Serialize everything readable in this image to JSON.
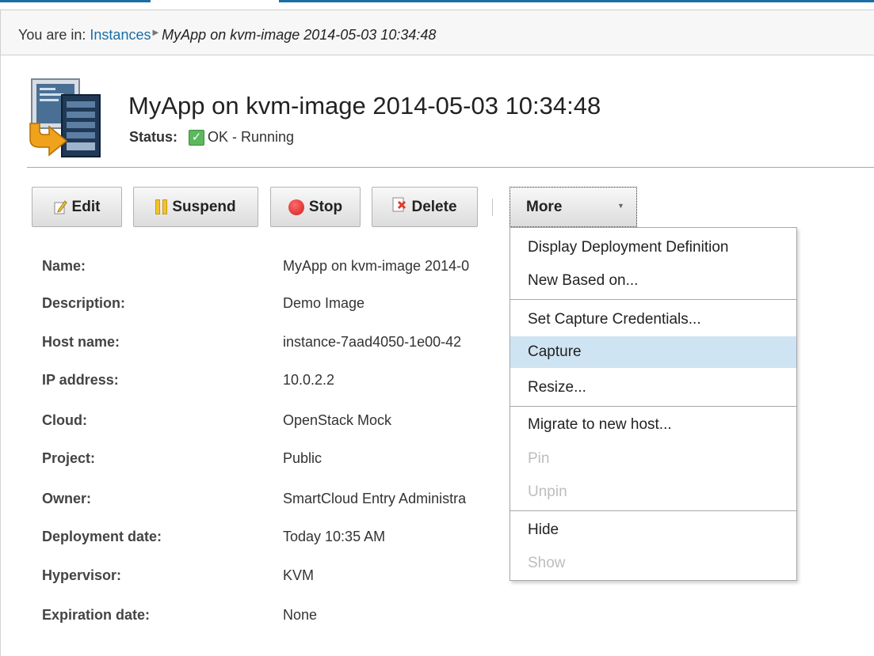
{
  "breadcrumb": {
    "prefix": "You are in:",
    "link": "Instances",
    "current": "MyApp on kvm-image 2014-05-03 10:34:48"
  },
  "header": {
    "title": "MyApp on kvm-image 2014-05-03 10:34:48",
    "status_label": "Status:",
    "status_value": "OK - Running",
    "status_color": "#5cb85c"
  },
  "toolbar": {
    "edit_label": "Edit",
    "suspend_label": "Suspend",
    "stop_label": "Stop",
    "delete_label": "Delete",
    "more_label": "More"
  },
  "properties": [
    {
      "label": "Name:",
      "value": "MyApp on kvm-image 2014-0"
    },
    {
      "label": "Description:",
      "value": "Demo Image"
    },
    {
      "label": "Host name:",
      "value": "instance-7aad4050-1e00-42"
    },
    {
      "label": "IP address:",
      "value": "10.0.2.2"
    },
    {
      "label": "Cloud:",
      "value": "OpenStack Mock"
    },
    {
      "label": "Project:",
      "value": "Public"
    },
    {
      "label": "Owner:",
      "value": "SmartCloud Entry Administra"
    },
    {
      "label": "Deployment date:",
      "value": "Today 10:35 AM"
    },
    {
      "label": "Hypervisor:",
      "value": "KVM"
    },
    {
      "label": "Expiration date:",
      "value": "None"
    }
  ],
  "more_menu": {
    "items": [
      {
        "label": "Display Deployment Definition",
        "enabled": true
      },
      {
        "label": "New Based on...",
        "enabled": true
      },
      {
        "label": "Set Capture Credentials...",
        "enabled": true
      },
      {
        "label": "Capture",
        "enabled": true,
        "highlighted": true
      },
      {
        "label": "Resize...",
        "enabled": true
      },
      {
        "label": "Migrate to new host...",
        "enabled": true
      },
      {
        "label": "Pin",
        "enabled": false
      },
      {
        "label": "Unpin",
        "enabled": false
      },
      {
        "label": "Hide",
        "enabled": true
      },
      {
        "label": "Show",
        "enabled": false
      }
    ]
  },
  "colors": {
    "accent": "#1a6ea8",
    "menu_highlight": "#cfe4f2"
  }
}
